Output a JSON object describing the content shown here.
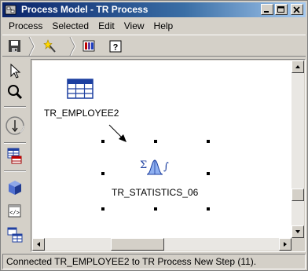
{
  "window": {
    "title": "Process Model - TR Process"
  },
  "menu": {
    "items": [
      {
        "label": "Process"
      },
      {
        "label": "Selected"
      },
      {
        "label": "Edit"
      },
      {
        "label": "View"
      },
      {
        "label": "Help"
      }
    ]
  },
  "toolbar": {
    "icons": [
      "save-icon",
      "magic-wand-icon",
      "color-palette-icon",
      "help-icon"
    ]
  },
  "palette": {
    "icons": [
      "pointer-icon",
      "zoom-icon",
      "connector-icon",
      "table-step-icon",
      "cube-icon",
      "code-step-icon",
      "transform-icon"
    ]
  },
  "diagram": {
    "nodes": [
      {
        "label": "TR_EMPLOYEE2",
        "icon": "table-icon"
      },
      {
        "label": "TR_STATISTICS_06",
        "icon": "statistics-icon"
      }
    ]
  },
  "status": {
    "text": "Connected TR_EMPLOYEE2 to TR Process New Step (11)."
  },
  "colors": {
    "title_start": "#0a246a",
    "title_end": "#a6caf0",
    "face": "#d4d0c8",
    "canvas": "#ffffff"
  }
}
